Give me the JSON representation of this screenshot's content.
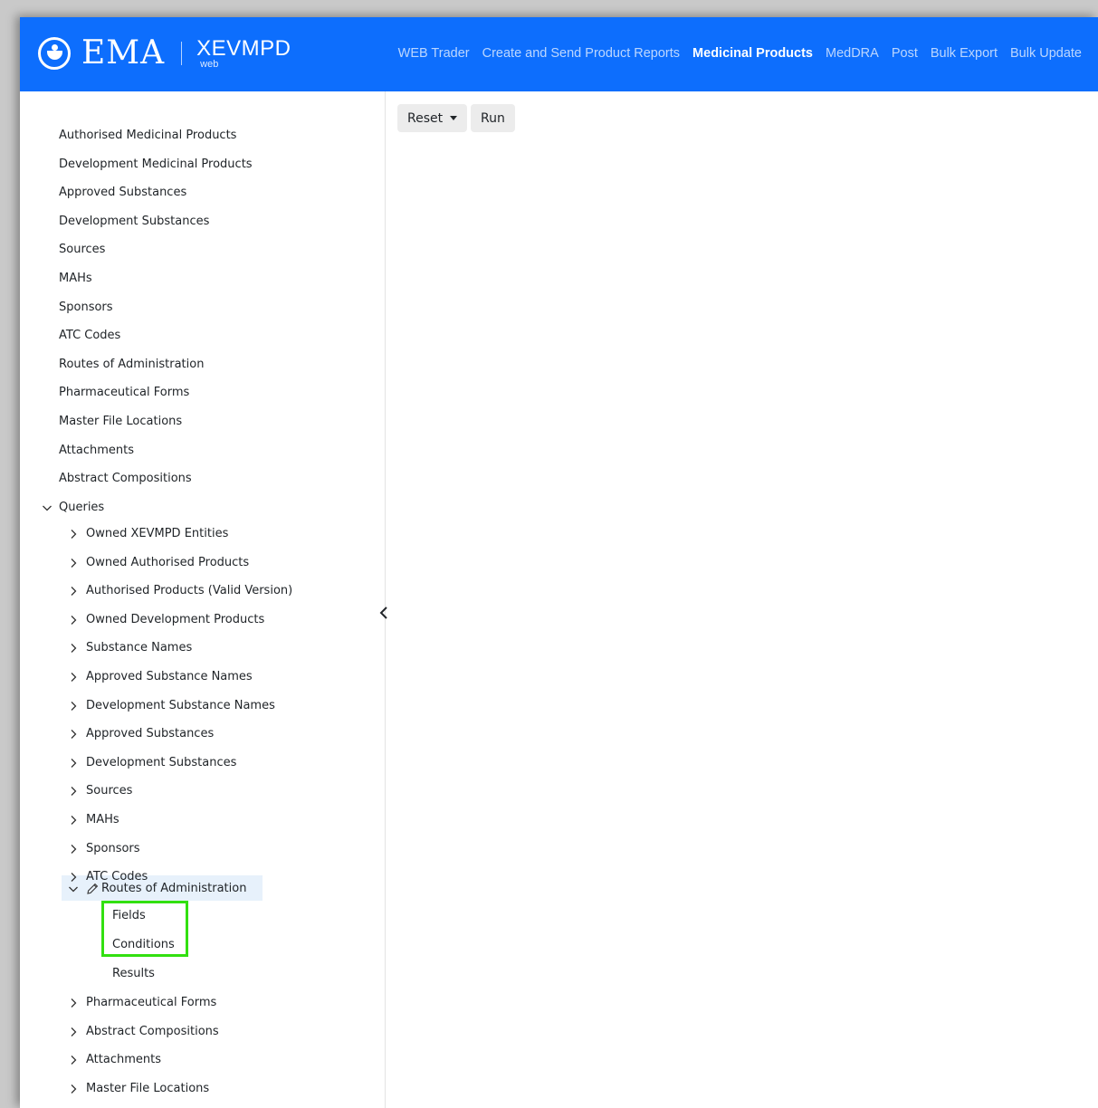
{
  "header": {
    "logo_text": "EMA",
    "product": "XEVMPD",
    "product_sub": "web",
    "nav": [
      "WEB Trader",
      "Create and Send Product Reports",
      "Medicinal Products",
      "MedDRA",
      "Post",
      "Bulk Export",
      "Bulk Update"
    ],
    "active_nav": "Medicinal Products"
  },
  "sidebar": {
    "top_items": [
      "Authorised Medicinal Products",
      "Development Medicinal Products",
      "Approved Substances",
      "Development Substances",
      "Sources",
      "MAHs",
      "Sponsors",
      "ATC Codes",
      "Routes of Administration",
      "Pharmaceutical Forms",
      "Master File Locations",
      "Attachments",
      "Abstract Compositions"
    ],
    "queries_label": "Queries",
    "queries_items_before": [
      "Owned XEVMPD Entities",
      "Owned Authorised Products",
      "Authorised Products (Valid Version)",
      "Owned Development Products",
      "Substance Names",
      "Approved Substance Names",
      "Development Substance Names",
      "Approved Substances",
      "Development Substances",
      "Sources",
      "MAHs",
      "Sponsors",
      "ATC Codes"
    ],
    "expanded_query": "Routes of Administration",
    "expanded_children": [
      "Fields",
      "Conditions",
      "Results"
    ],
    "queries_items_after": [
      "Pharmaceutical Forms",
      "Abstract Compositions",
      "Attachments",
      "Master File Locations"
    ]
  },
  "toolbar": {
    "reset_label": "Reset",
    "run_label": "Run"
  },
  "colors": {
    "brand": "#0d6efd",
    "selected_row": "#e7f1fb",
    "annotation_highlight": "#32e010"
  },
  "icons": {
    "logo": "ema-logo-icon",
    "expanded": "chevron-down-icon",
    "collapsed": "chevron-right-icon",
    "edit": "pencil-icon",
    "collapse_sidebar": "chevron-left-icon"
  }
}
